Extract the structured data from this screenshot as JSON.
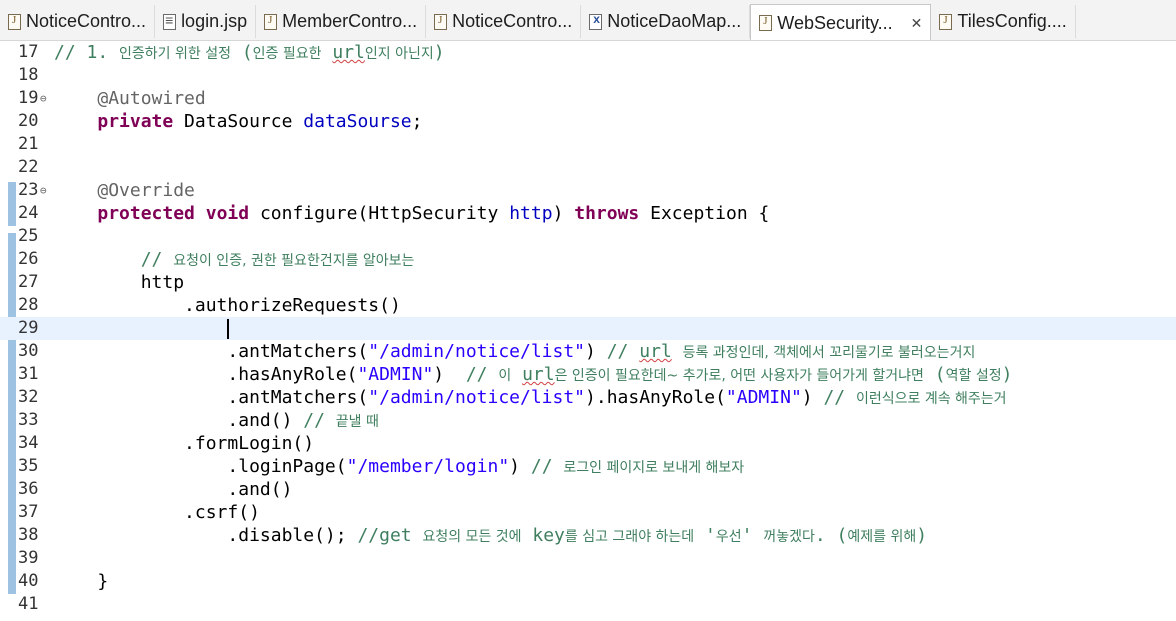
{
  "tabs": [
    {
      "label": "NoticeContro...",
      "icon": "java-file-icon"
    },
    {
      "label": "login.jsp",
      "icon": "jsp-file-icon"
    },
    {
      "label": "MemberContro...",
      "icon": "java-file-icon"
    },
    {
      "label": "NoticeContro...",
      "icon": "java-file-icon"
    },
    {
      "label": "NoticeDaoMap...",
      "icon": "xml-file-icon"
    },
    {
      "label": "WebSecurity...",
      "icon": "java-file-icon",
      "active": true,
      "close": "✕"
    },
    {
      "label": "TilesConfig....",
      "icon": "java-file-icon"
    }
  ],
  "editor": {
    "current_line": 29,
    "lines": [
      {
        "n": "17",
        "text": "// 1. 인증하기 위한 설정 (인증 필요한 url인지 아닌지)"
      },
      {
        "n": "18",
        "text": ""
      },
      {
        "n": "19",
        "text": "    @Autowired",
        "fold": "⊖"
      },
      {
        "n": "20",
        "text": "    private DataSource dataSourse;"
      },
      {
        "n": "21",
        "text": ""
      },
      {
        "n": "22",
        "text": ""
      },
      {
        "n": "23",
        "text": "    @Override",
        "fold": "⊖"
      },
      {
        "n": "24",
        "text": "    protected void configure(HttpSecurity http) throws Exception {"
      },
      {
        "n": "25",
        "text": ""
      },
      {
        "n": "26",
        "text": "        // 요청이 인증, 권한 필요한건지를 알아보는"
      },
      {
        "n": "27",
        "text": "        http"
      },
      {
        "n": "28",
        "text": "            .authorizeRequests()"
      },
      {
        "n": "29",
        "text": ""
      },
      {
        "n": "30",
        "text": "                .antMatchers(\"/admin/notice/list\") // url 등록 과정인데, 객체에서 꼬리물기로 불러오는거지"
      },
      {
        "n": "31",
        "text": "                .hasAnyRole(\"ADMIN\")  // 이 url은 인증이 필요한데~ 추가로, 어떤 사용자가 들어가게 할거냐면 (역할 설정)"
      },
      {
        "n": "32",
        "text": "                .antMatchers(\"/admin/notice/list\").hasAnyRole(\"ADMIN\") // 이런식으로 계속 해주는거"
      },
      {
        "n": "33",
        "text": "                .and() // 끝낼 때"
      },
      {
        "n": "34",
        "text": "            .formLogin()"
      },
      {
        "n": "35",
        "text": "                .loginPage(\"/member/login\") // 로그인 페이지로 보내게 해보자"
      },
      {
        "n": "36",
        "text": "                .and()"
      },
      {
        "n": "37",
        "text": "            .csrf()"
      },
      {
        "n": "38",
        "text": "                .disable(); //get 요청의 모든 것에 key를 심고 그래야 하는데 '우선' 꺼놓겠다. (예제를 위해)"
      },
      {
        "n": "39",
        "text": ""
      },
      {
        "n": "40",
        "text": "    }"
      },
      {
        "n": "41",
        "text": ""
      }
    ]
  },
  "colors": {
    "keyword": "#7f0055",
    "annotation": "#646464",
    "field": "#0000c0",
    "string": "#2a00ff",
    "comment": "#3f7f5f",
    "current_line_bg": "#e8f2fe",
    "ruler": "#9ec3e2"
  }
}
